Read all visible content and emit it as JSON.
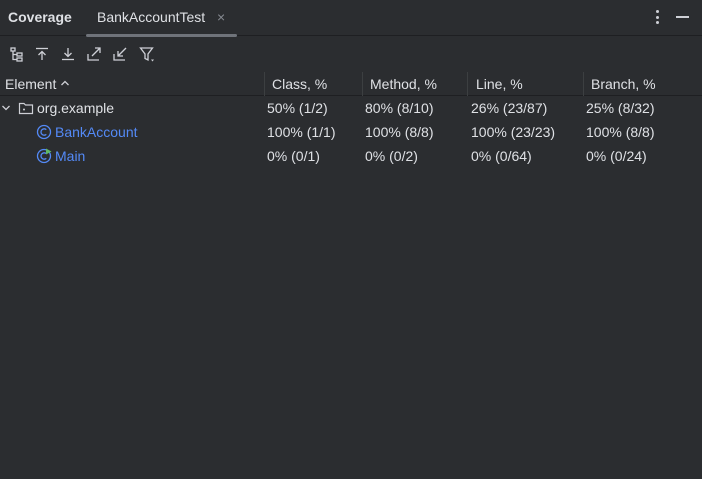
{
  "panel": {
    "title": "Coverage",
    "tab_label": "BankAccountTest",
    "tab_close": "×"
  },
  "toolbar": {
    "buttons": [
      {
        "icon": "flatten-packages-icon"
      },
      {
        "icon": "navigate-up-icon"
      },
      {
        "icon": "navigate-down-icon"
      },
      {
        "icon": "export-icon"
      },
      {
        "icon": "import-icon"
      },
      {
        "icon": "filter-icon"
      }
    ]
  },
  "table": {
    "headers": [
      "Element",
      "Class, %",
      "Method, %",
      "Line, %",
      "Branch, %"
    ],
    "sort_indicator": "ascending",
    "rows": [
      {
        "name": "org.example",
        "icon": "package-icon",
        "class": "50% (1/2)",
        "method": "80% (8/10)",
        "line": "26% (23/87)",
        "branch": "25% (8/32)"
      },
      {
        "name": "BankAccount",
        "icon": "class-icon",
        "class": "100% (1/1)",
        "method": "100% (8/8)",
        "line": "100% (23/23)",
        "branch": "100% (8/8)"
      },
      {
        "name": "Main",
        "icon": "runnable-class-icon",
        "class": "0% (0/1)",
        "method": "0% (0/2)",
        "line": "0% (0/64)",
        "branch": "0% (0/24)"
      }
    ]
  },
  "colors": {
    "background": "#2b2d30",
    "text": "#dfe1e5",
    "link": "#548af7",
    "run_badge": "#5fb865"
  }
}
